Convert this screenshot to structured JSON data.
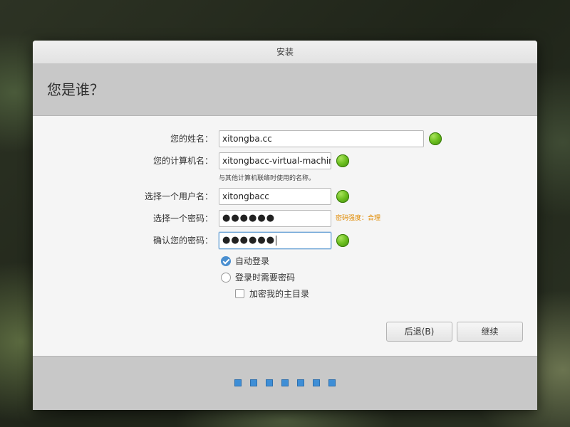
{
  "window": {
    "title": "安装"
  },
  "header": {
    "title": "您是谁？"
  },
  "form": {
    "name": {
      "label": "您的姓名：",
      "value": "xitongba.cc"
    },
    "computer": {
      "label": "您的计算机名：",
      "value": "xitongbacc-virtual-machine",
      "hint": "与其他计算机联络时使用的名称。"
    },
    "username": {
      "label": "选择一个用户名：",
      "value": "xitongbacc"
    },
    "password": {
      "label": "选择一个密码：",
      "value": "●●●●●●",
      "strength": "密码强度：合理"
    },
    "confirm": {
      "label": "确认您的密码：",
      "value": "●●●●●●"
    }
  },
  "options": {
    "auto_login": "自动登录",
    "require_password": "登录时需要密码",
    "encrypt_home": "加密我的主目录"
  },
  "buttons": {
    "back": "后退(B)",
    "continue": "继续"
  },
  "progress": {
    "steps": 7,
    "current": 7
  },
  "colors": {
    "accent": "#3e8ed6",
    "ok": "#6cbf1f",
    "strength": "#e08a00"
  }
}
